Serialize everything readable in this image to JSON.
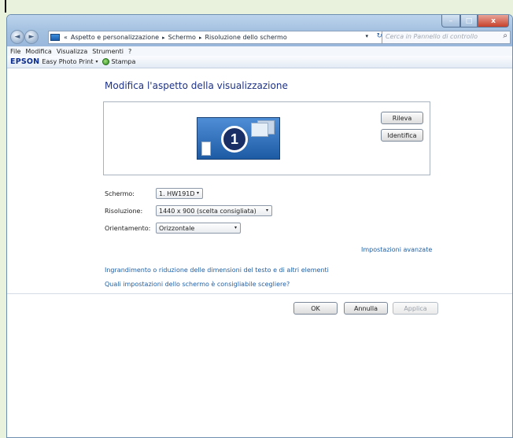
{
  "window": {
    "controls": {
      "minimize": "–",
      "maximize": "□",
      "close": "x"
    }
  },
  "addressbar": {
    "back_glyph": "◄",
    "forward_glyph": "►",
    "prefix": "«",
    "crumbs": [
      "Aspetto e personalizzazione",
      "Schermo",
      "Risoluzione dello schermo"
    ],
    "separator": "▸",
    "dropdown_glyph": "▾",
    "refresh_glyph": "↻",
    "icon": "control-panel-icon"
  },
  "search": {
    "placeholder": "Cerca in Pannello di controllo",
    "icon": "search-icon",
    "glyph": "⌕"
  },
  "menubar": {
    "items": [
      "File",
      "Modifica",
      "Visualizza",
      "Strumenti",
      "?"
    ]
  },
  "toolbar": {
    "brand": "EPSON",
    "app_label": "Easy Photo Print",
    "dropdown_glyph": "▾",
    "print_label": "Stampa"
  },
  "main": {
    "title": "Modifica l'aspetto della visualizzazione",
    "monitor_number": "1",
    "detect_label": "Rileva",
    "identify_label": "Identifica",
    "screen_label": "Schermo:",
    "screen_value": "1. HW191D",
    "resolution_label": "Risoluzione:",
    "resolution_value": "1440 x 900 (scelta consigliata)",
    "orientation_label": "Orientamento:",
    "orientation_value": "Orizzontale",
    "advanced_link": "Impostazioni avanzate",
    "text_size_link": "Ingrandimento o riduzione delle dimensioni del testo e di altri elementi",
    "which_settings_link": "Quali impostazioni dello schermo è consigliabile scegliere?",
    "dropdown_glyph": "▾"
  },
  "footer": {
    "ok_label": "OK",
    "cancel_label": "Annulla",
    "apply_label": "Applica"
  },
  "colors": {
    "title": "#1e3287",
    "link": "#1f5fa6",
    "titlebar": "#a7c3e2"
  }
}
